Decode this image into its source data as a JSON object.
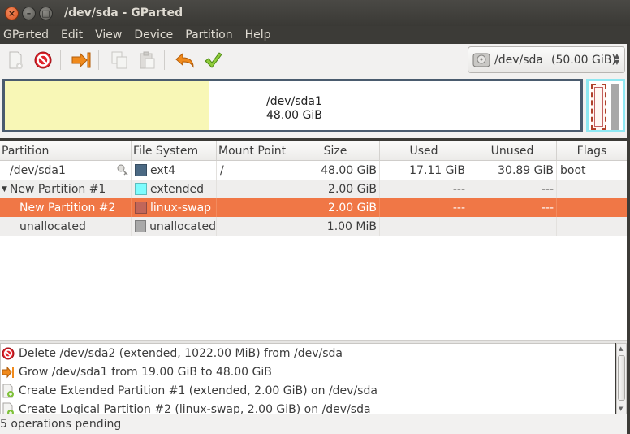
{
  "window": {
    "title": "/dev/sda - GParted"
  },
  "menu": [
    "GParted",
    "Edit",
    "View",
    "Device",
    "Partition",
    "Help"
  ],
  "device_selector": {
    "device": "/dev/sda",
    "size": "(50.00 GiB)"
  },
  "partition_map": {
    "label_name": "/dev/sda1",
    "label_size": "48.00 GiB",
    "used_fraction": 0.354
  },
  "table": {
    "headers": [
      "Partition",
      "File System",
      "Mount Point",
      "Size",
      "Used",
      "Unused",
      "Flags"
    ],
    "rows": [
      {
        "partition": "/dev/sda1",
        "fs": "ext4",
        "fs_color": "#4b6983",
        "mount": "/",
        "size": "48.00 GiB",
        "used": "17.11 GiB",
        "unused": "30.89 GiB",
        "flags": "boot"
      },
      {
        "partition": "New Partition #1",
        "fs": "extended",
        "fs_color": "#7dfcfe",
        "mount": "",
        "size": "2.00 GiB",
        "used": "---",
        "unused": "---",
        "flags": ""
      },
      {
        "partition": "New Partition #2",
        "fs": "linux-swap",
        "fs_color": "#c1665a",
        "mount": "",
        "size": "2.00 GiB",
        "used": "---",
        "unused": "---",
        "flags": ""
      },
      {
        "partition": "unallocated",
        "fs": "unallocated",
        "fs_color": "#a9a9a9",
        "mount": "",
        "size": "1.00 MiB",
        "used": "",
        "unused": "",
        "flags": ""
      }
    ]
  },
  "operations": [
    {
      "icon": "delete-icon",
      "text": "Delete /dev/sda2 (extended, 1022.00 MiB) from /dev/sda"
    },
    {
      "icon": "resize-icon",
      "text": "Grow /dev/sda1 from 19.00 GiB to 48.00 GiB"
    },
    {
      "icon": "new-partition-icon",
      "text": "Create Extended Partition #1 (extended, 2.00 GiB) on /dev/sda"
    },
    {
      "icon": "new-partition-icon",
      "text": "Create Logical Partition #2 (linux-swap, 2.00 GiB) on /dev/sda"
    }
  ],
  "status": {
    "text": "5 operations pending"
  },
  "colors": {
    "selection": "#f07746",
    "ext4": "#4b6983",
    "extended": "#7dfcfe",
    "swap": "#c1665a",
    "unallocated": "#a9a9a9"
  }
}
